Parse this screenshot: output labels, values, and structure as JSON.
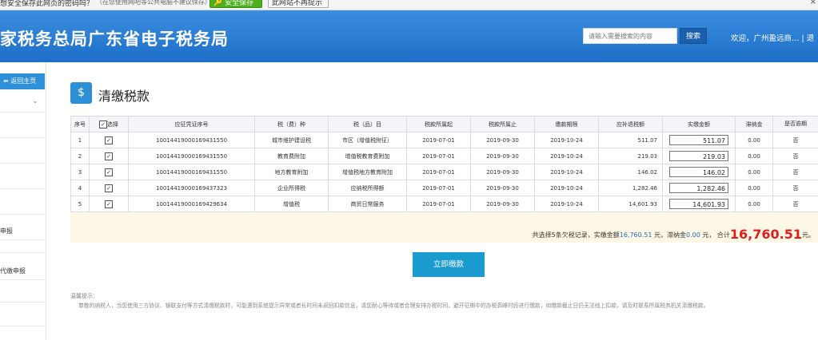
{
  "password_bar": {
    "question": "想安全保存此网页的密码吗？",
    "suggestion": "（在您使用网吧等公共电脑不建议保存）",
    "save_label": "安全保存",
    "never_label": "此网站不再提示",
    "close_label": "×"
  },
  "header": {
    "title": "家税务总局广东省电子税务局",
    "search_placeholder": "请输入需要搜索的内容",
    "search_button": "搜索",
    "welcome": "欢迎，广州盈远商…  |  退"
  },
  "sidebar": {
    "back_label": "返回主页",
    "items": [
      "申报",
      "代缴申报"
    ]
  },
  "page": {
    "title": "清缴税款"
  },
  "table": {
    "headers": [
      "序号",
      "选择",
      "应征凭证序号",
      "税（费）种",
      "税（品）目",
      "税款所属起",
      "税款所属止",
      "缴款期限",
      "应补退税额",
      "实缴金额",
      "滞纳金",
      "是否逾期"
    ],
    "rows": [
      {
        "no": "1",
        "checked": "✓",
        "voucher": "10014419000169431550",
        "tax_type": "城市维护建设税",
        "item": "市区（增值税附征）",
        "start": "2019-07-01",
        "end": "2019-09-30",
        "deadline": "2019-10-24",
        "due": "511.07",
        "paid": "511.07",
        "late_fee": "0.00",
        "overdue": "否"
      },
      {
        "no": "2",
        "checked": "✓",
        "voucher": "10014419000169431550",
        "tax_type": "教育费附加",
        "item": "增值税教育费附加",
        "start": "2019-07-01",
        "end": "2019-09-30",
        "deadline": "2019-10-24",
        "due": "219.03",
        "paid": "219.03",
        "late_fee": "0.00",
        "overdue": "否"
      },
      {
        "no": "3",
        "checked": "✓",
        "voucher": "10014419000169431550",
        "tax_type": "地方教育附加",
        "item": "增值税地方教育附加",
        "start": "2019-07-01",
        "end": "2019-09-30",
        "deadline": "2019-10-24",
        "due": "146.02",
        "paid": "146.02",
        "late_fee": "0.00",
        "overdue": "否"
      },
      {
        "no": "4",
        "checked": "✓",
        "voucher": "10014419000169437323",
        "tax_type": "企业所得税",
        "item": "应纳税所得额",
        "start": "2019-07-01",
        "end": "2019-09-30",
        "deadline": "2019-10-24",
        "due": "1,282.46",
        "paid": "1,282.46",
        "late_fee": "0.00",
        "overdue": "否"
      },
      {
        "no": "5",
        "checked": "✓",
        "voucher": "10014419000169429634",
        "tax_type": "增值税",
        "item": "商贸日常服务",
        "start": "2019-07-01",
        "end": "2019-09-30",
        "deadline": "2019-10-24",
        "due": "14,601.93",
        "paid": "14,601.93",
        "late_fee": "0.00",
        "overdue": "否"
      }
    ]
  },
  "summary": {
    "prefix": "共选择5条欠税记录，实缴金额",
    "paid_total": "16,760.51",
    "mid1": " 元，滞纳金",
    "late_total": "0.00",
    "mid2": " 元， 合计",
    "grand_total": "16,760.51",
    "suffix": "元。"
  },
  "pay_button": "立即缴款",
  "tips": {
    "heading": "温馨提示：",
    "body": "尊敬的纳税人，当您使用三方协议、银联支付等方式清缴税款时，可能遇到系统提示异常或者长时间未返回扣款信息，请您耐心等待或者合理安排办税时间，避开征期中的办税高峰时段进行缴款，如缴款截止日仍无法线上扣款，请及时联系所属税务机关清缴税款。"
  },
  "colors": {
    "header_blue": "#1e6fc7",
    "button_blue": "#1a9bd0",
    "total_red": "#e21d1d",
    "amount_blue": "#1f6cc4"
  }
}
